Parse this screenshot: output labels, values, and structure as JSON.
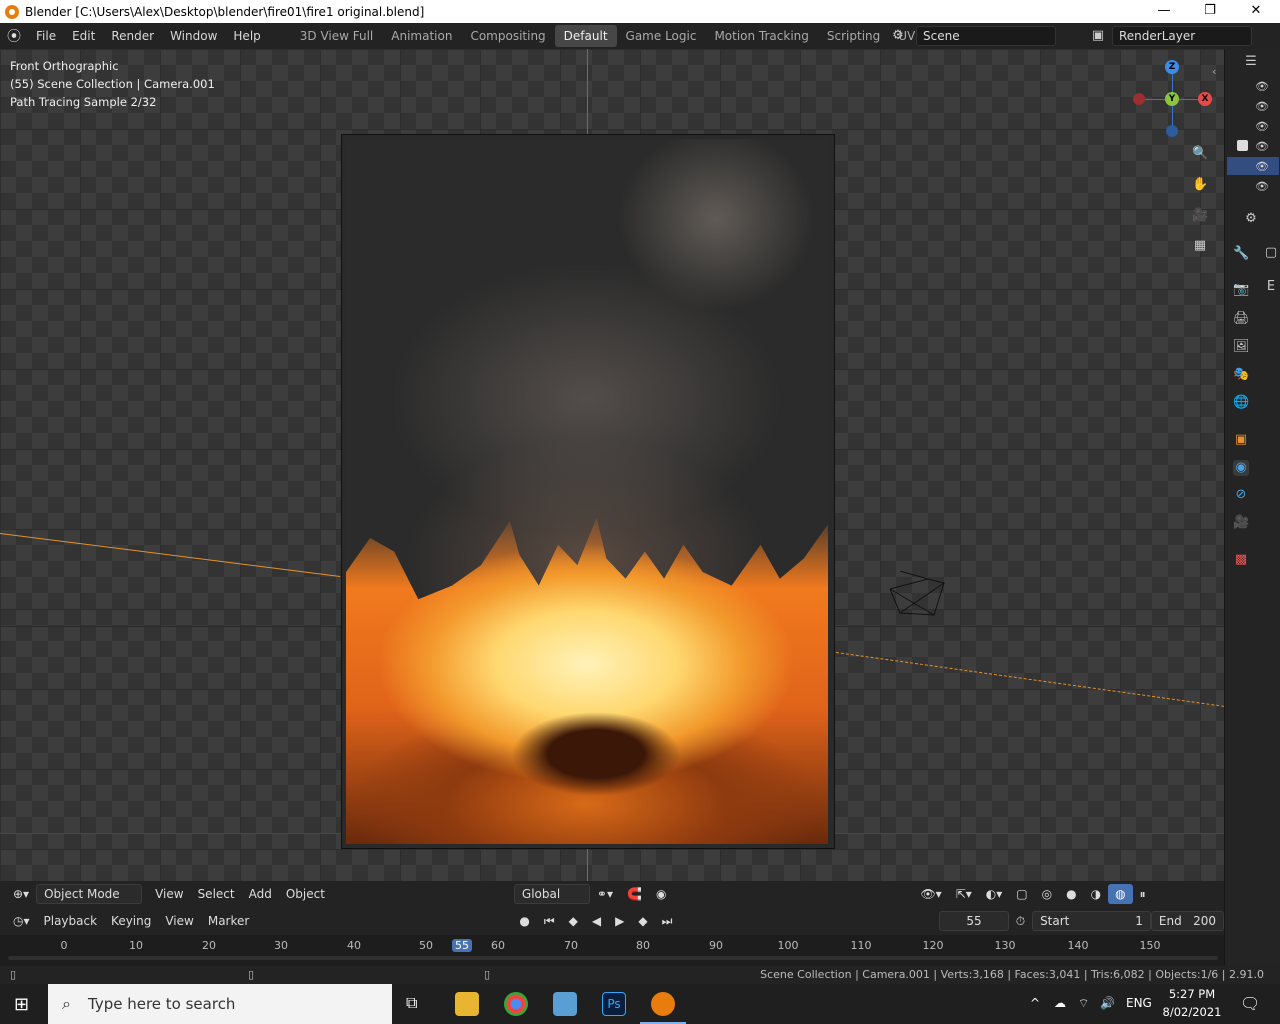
{
  "window": {
    "title": "Blender [C:\\Users\\Alex\\Desktop\\blender\\fire01\\fire1 original.blend]",
    "minimize": "—",
    "maximize": "❐",
    "close": "✕"
  },
  "menus": [
    "File",
    "Edit",
    "Render",
    "Window",
    "Help"
  ],
  "workspaces": [
    {
      "label": "3D View Full",
      "active": false
    },
    {
      "label": "Animation",
      "active": false
    },
    {
      "label": "Compositing",
      "active": false
    },
    {
      "label": "Default",
      "active": true
    },
    {
      "label": "Game Logic",
      "active": false
    },
    {
      "label": "Motion Tracking",
      "active": false
    },
    {
      "label": "Scripting",
      "active": false
    },
    {
      "label": "UV Editing",
      "active": false
    },
    {
      "label": "V",
      "active": false
    }
  ],
  "scene_field": "Scene",
  "renderlayer_field": "RenderLayer",
  "viewport": {
    "view_name": "Front Orthographic",
    "collection": "(55) Scene Collection | Camera.001",
    "sample": "Path Tracing Sample 2/32",
    "gizmo": {
      "z": "Z",
      "y": "Y",
      "x": "X"
    }
  },
  "header3d": {
    "mode": "Object Mode",
    "menus": [
      "View",
      "Select",
      "Add",
      "Object"
    ],
    "orientation": "Global"
  },
  "timeline": {
    "menus": [
      "Playback",
      "Keying",
      "View",
      "Marker"
    ],
    "current_frame": "55",
    "start_label": "Start",
    "start": "1",
    "end_label": "End",
    "end": "200",
    "ticks": [
      "0",
      "10",
      "20",
      "30",
      "40",
      "50",
      "55",
      "60",
      "70",
      "80",
      "90",
      "100",
      "110",
      "120",
      "130",
      "140",
      "150"
    ]
  },
  "status": {
    "text": "Scene Collection | Camera.001 | Verts:3,168 | Faces:3,041 | Tris:6,082 | Objects:1/6 | 2.91.0"
  },
  "taskbar": {
    "search_placeholder": "Type here to search",
    "lang": "ENG",
    "time": "5:27 PM",
    "date": "8/02/2021"
  },
  "colors": {
    "accent": "#4772b3",
    "x_axis": "#e84a4a",
    "y_axis": "#8cc43f",
    "z_axis": "#3d8de6",
    "fire": "#f39a2c"
  }
}
